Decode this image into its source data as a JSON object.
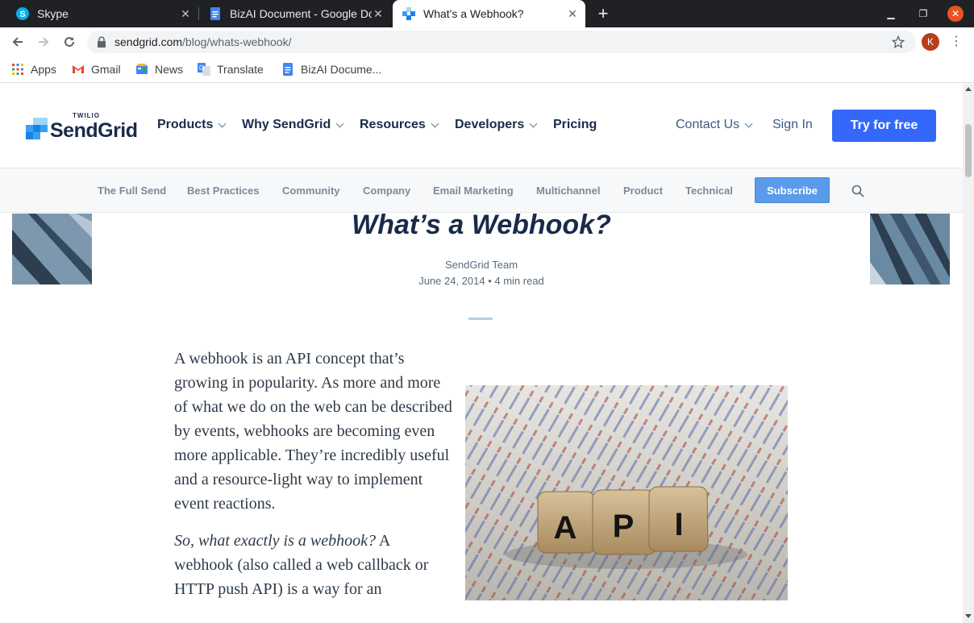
{
  "browser": {
    "tabs": [
      {
        "title": "Skype",
        "icon": "skype-icon"
      },
      {
        "title": "BizAI Document - Google Docs",
        "icon": "google-docs-icon"
      },
      {
        "title": "What's a Webhook?",
        "icon": "sendgrid-icon"
      }
    ],
    "new_tab_symbol": "+",
    "url_domain": "sendgrid.com",
    "url_path": "/blog/whats-webhook/",
    "profile_initial": "K",
    "bookmarks": [
      {
        "label": "Apps",
        "icon": "apps-grid-icon"
      },
      {
        "label": "Gmail",
        "icon": "gmail-icon"
      },
      {
        "label": "News",
        "icon": "news-icon"
      },
      {
        "label": "Translate",
        "icon": "translate-icon"
      },
      {
        "label": "BizAI Docume...",
        "icon": "google-docs-icon"
      }
    ]
  },
  "site": {
    "logo_top": "TWILIO",
    "logo_name": "SendGrid",
    "nav": {
      "products": "Products",
      "why": "Why SendGrid",
      "resources": "Resources",
      "developers": "Developers",
      "pricing": "Pricing",
      "contact": "Contact Us",
      "signin": "Sign In",
      "cta": "Try for free"
    },
    "subnav": [
      "The Full Send",
      "Best Practices",
      "Community",
      "Company",
      "Email Marketing",
      "Multichannel",
      "Product",
      "Technical"
    ],
    "subscribe": "Subscribe",
    "accent": "#3368fa"
  },
  "article": {
    "title": "What’s a Webhook?",
    "author": "SendGrid Team",
    "meta": "June 24, 2014 • 4 min read",
    "para1": "A webhook is an API concept that’s growing in popularity. As more and more of what we do on the web can be described by events, webhooks are becoming even more applicable. They’re incredibly useful and a resource-light way to implement event reactions.",
    "para2_em": "So, what exactly is a webhook?",
    "para2_rest": " A webhook (also called a web callback or HTTP push API) is a way for an",
    "image_letters": [
      "A",
      "P",
      "I"
    ]
  }
}
